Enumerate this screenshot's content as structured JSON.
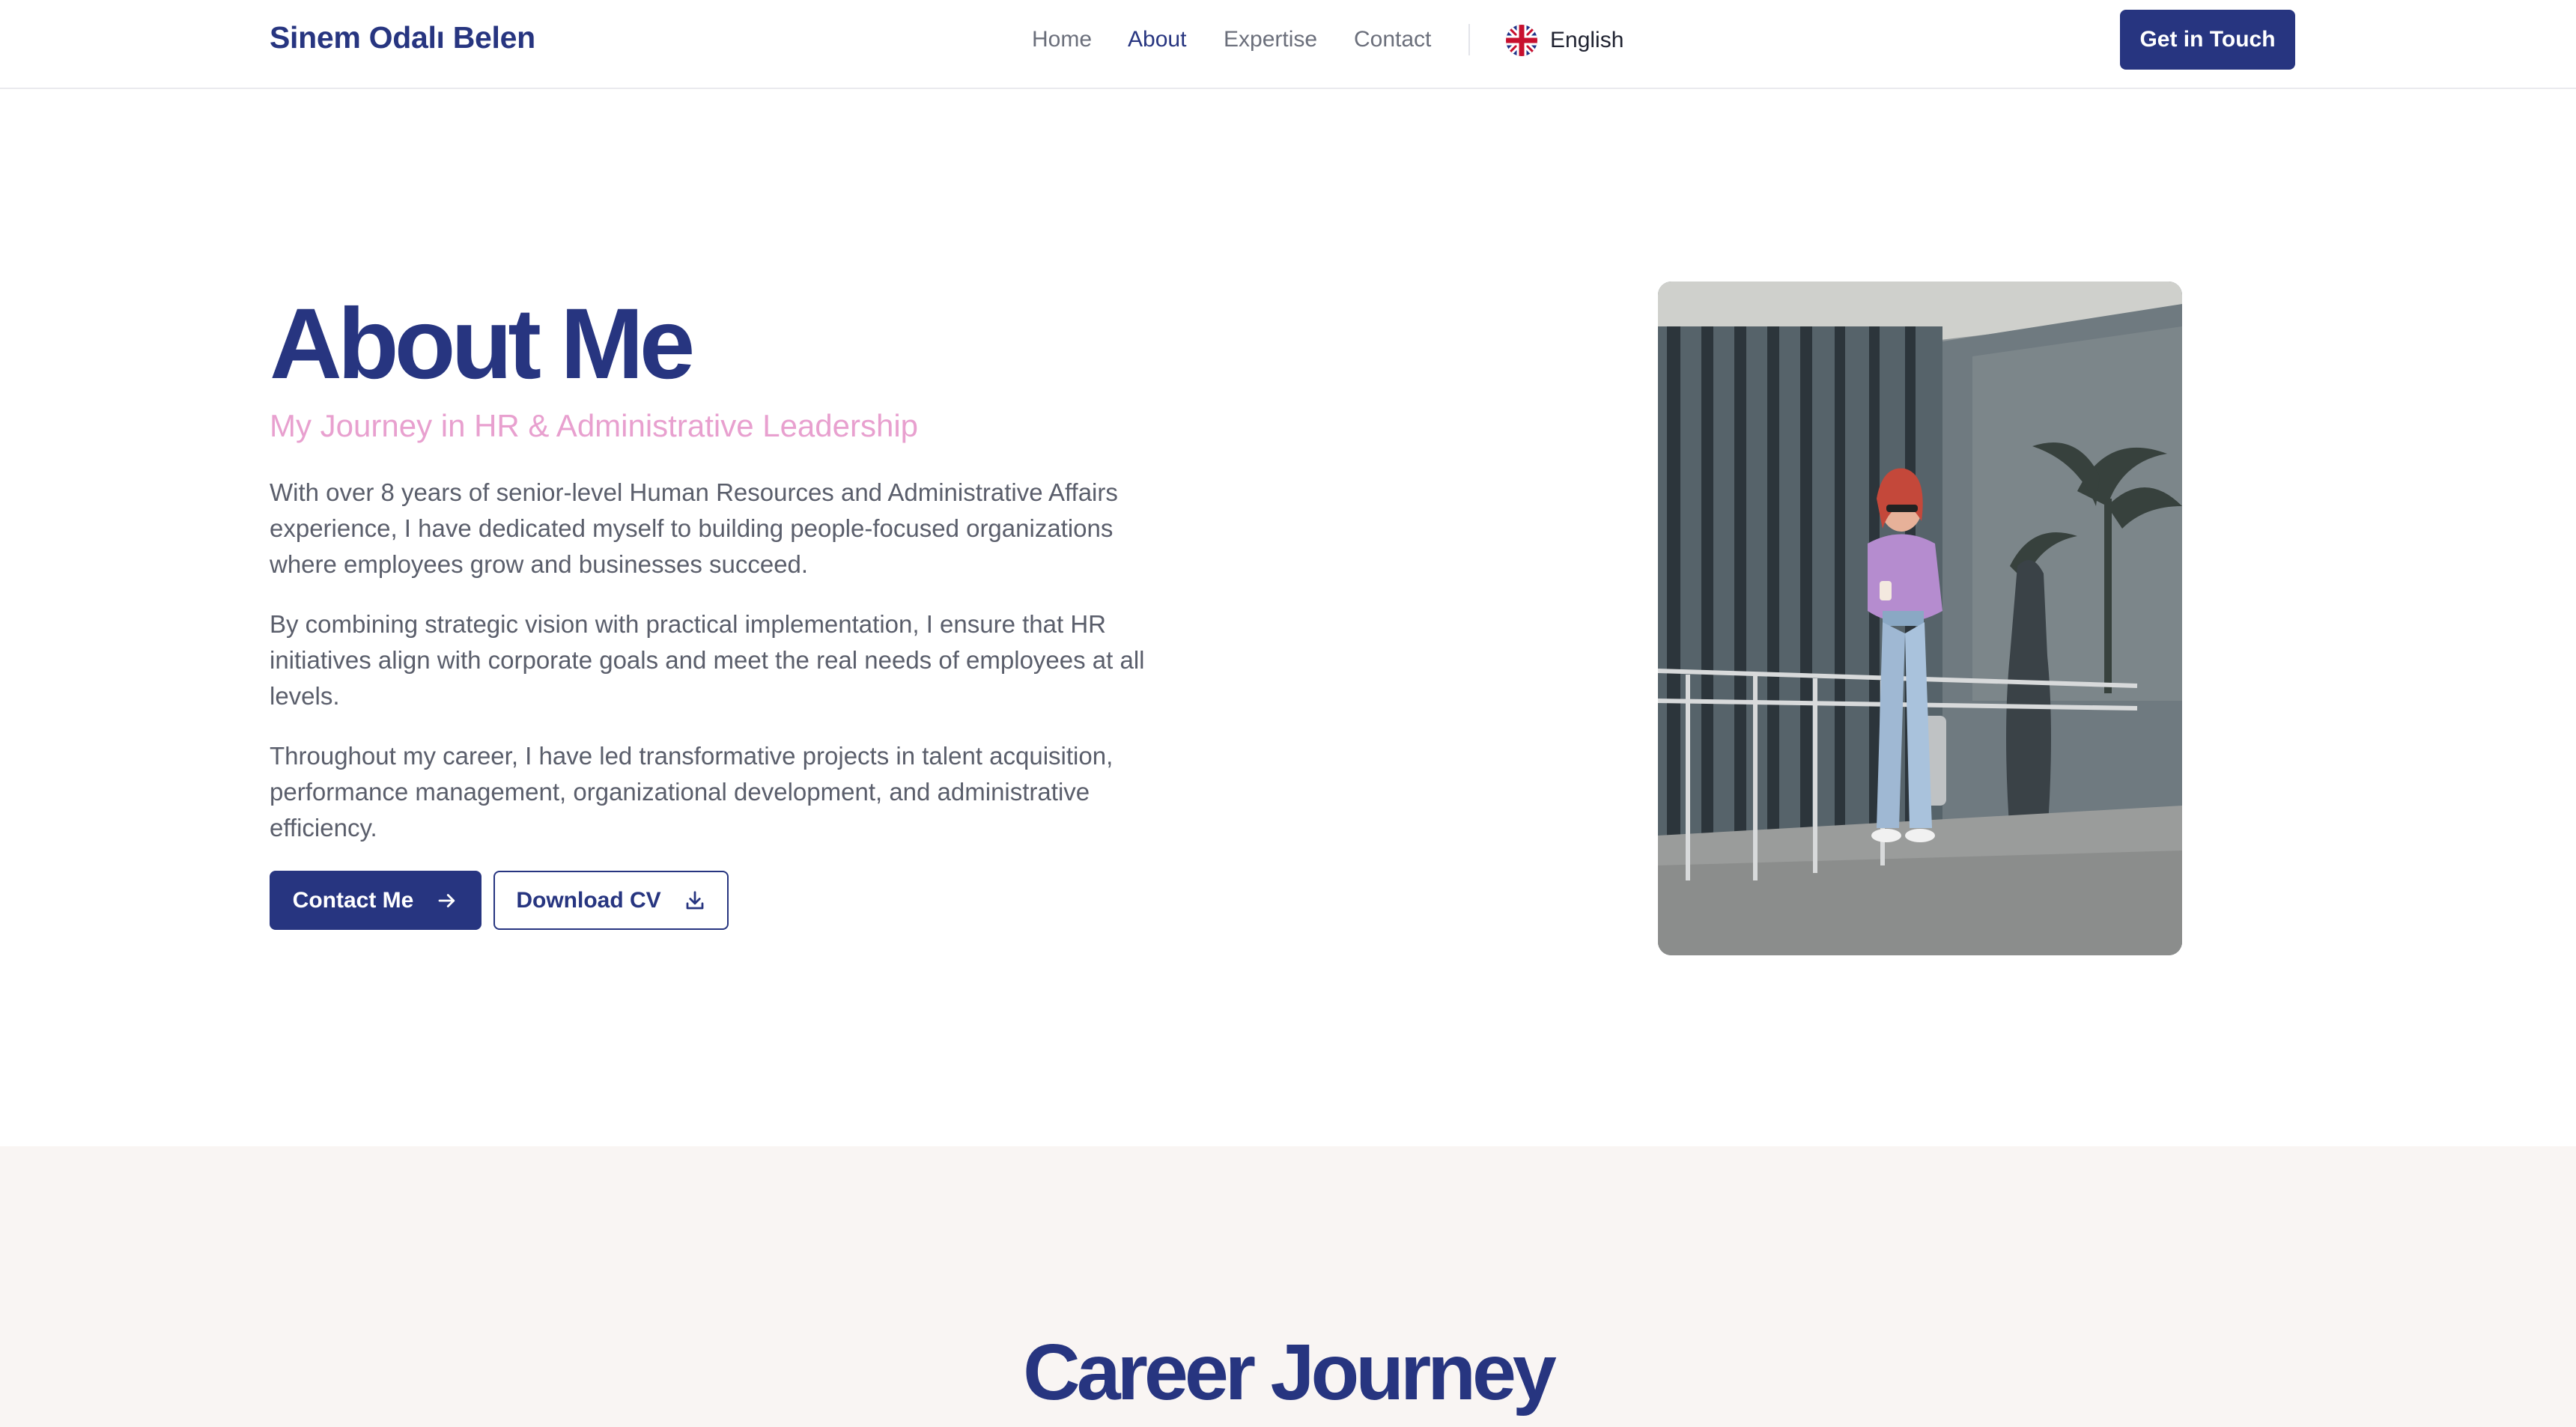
{
  "header": {
    "brand": "Sinem Odalı Belen",
    "nav": [
      {
        "label": "Home"
      },
      {
        "label": "About"
      },
      {
        "label": "Expertise"
      },
      {
        "label": "Contact"
      }
    ],
    "active_nav": "About",
    "language": {
      "label": "English",
      "icon": "uk-flag-icon"
    },
    "cta_label": "Get in Touch"
  },
  "hero": {
    "title": "About Me",
    "subtitle": "My Journey in HR & Administrative Leadership",
    "paragraphs": [
      "With over 8 years of senior-level Human Resources and Administrative Affairs experience, I have dedicated myself to building people-focused organizations where employees grow and businesses succeed.",
      "By combining strategic vision with practical implementation, I ensure that HR initiatives align with corporate goals and meet the real needs of employees at all levels.",
      "Throughout my career, I have led transformative projects in talent acquisition, performance management, organizational development, and administrative efficiency."
    ],
    "primary_button": {
      "label": "Contact Me",
      "icon": "arrow-right-icon"
    },
    "secondary_button": {
      "label": "Download CV",
      "icon": "download-icon"
    }
  },
  "career": {
    "title": "Career Journey"
  },
  "colors": {
    "brand": "#273580",
    "accent_pink": "#e8a0cf",
    "body_text": "#5a5e6b",
    "section_bg": "#f9f5f3"
  }
}
